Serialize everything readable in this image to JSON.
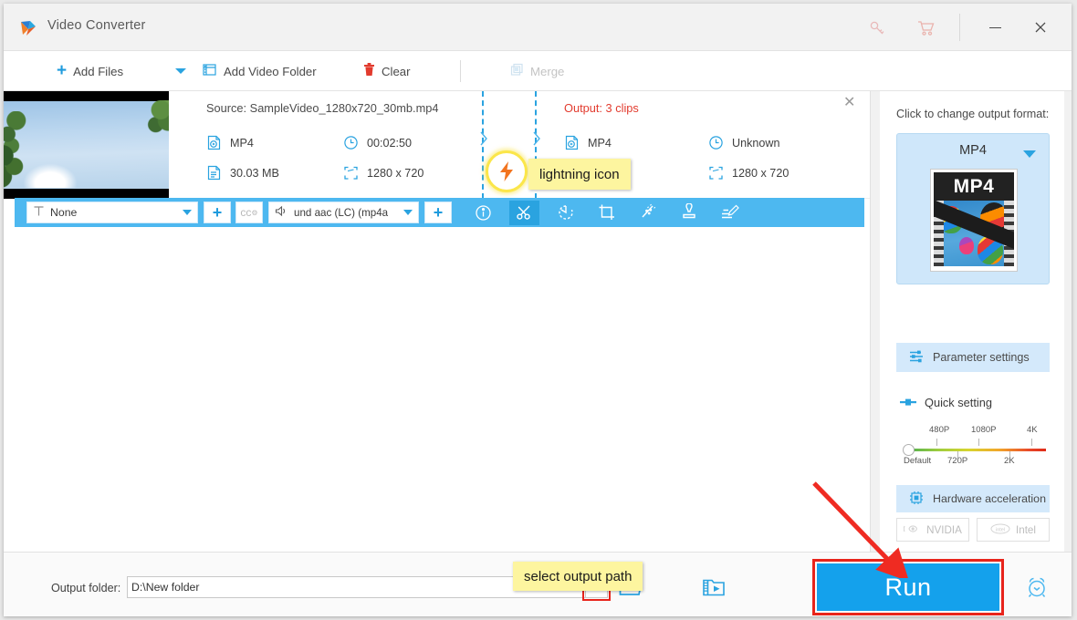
{
  "titlebar": {
    "app_title": "Video Converter",
    "icons": [
      "key-icon",
      "cart-icon"
    ],
    "minimize": "–",
    "close": "✕"
  },
  "menu": {
    "add_files": "Add Files",
    "add_video_folder": "Add Video Folder",
    "clear": "Clear",
    "merge": "Merge"
  },
  "file_row": {
    "source_title": "Source: SampleVideo_1280x720_30mb.mp4",
    "output_title": "Output: 3 clips",
    "source": {
      "format": "MP4",
      "duration": "00:02:50",
      "size": "30.03 MB",
      "resolution": "1280 x 720"
    },
    "output": {
      "format": "MP4",
      "duration": "Unknown",
      "resolution": "1280 x 720"
    },
    "close": "✕"
  },
  "toolbar": {
    "subtitle_value": "None",
    "subtitle_add": "+",
    "cc_label": "cc",
    "audio_value": "und aac (LC) (mp4a",
    "audio_add": "+",
    "tools": [
      {
        "name": "info-icon",
        "active": false
      },
      {
        "name": "cut-icon",
        "active": true
      },
      {
        "name": "rotate-icon",
        "active": false
      },
      {
        "name": "crop-icon",
        "active": false
      },
      {
        "name": "effect-icon",
        "active": false
      },
      {
        "name": "watermark-icon",
        "active": false
      },
      {
        "name": "subtitle-icon",
        "active": false
      }
    ]
  },
  "right_panel": {
    "prompt": "Click to change output format:",
    "format_name": "MP4",
    "format_thumb_label": "MP4",
    "parameter_settings": "Parameter settings",
    "quick_setting": "Quick setting",
    "slider": {
      "top_labels": [
        "480P",
        "1080P",
        "4K"
      ],
      "bottom_labels": [
        "Default",
        "720P",
        "2K"
      ],
      "value": "Default"
    },
    "hardware_acceleration": "Hardware acceleration",
    "gpu": [
      {
        "label": "NVIDIA",
        "icon": "nvidia-icon"
      },
      {
        "label": "Intel",
        "icon": "intel-icon"
      }
    ]
  },
  "bottom": {
    "output_folder_label": "Output folder:",
    "output_folder_value": "D:\\New folder",
    "open_folder_icon": "folder-icon",
    "media_folder_icon": "media-folder-icon",
    "run_label": "Run",
    "alarm_icon": "alarm-clock-icon"
  },
  "annotations": {
    "lightning_note": "lightning icon",
    "output_path_note": "select output path"
  },
  "colors": {
    "accent_blue": "#14a1ec",
    "toolbar_blue": "#4db8f0",
    "highlight_yellow": "#fdf59f",
    "alert_red": "#e8241b",
    "output_red": "#e23b2e"
  }
}
